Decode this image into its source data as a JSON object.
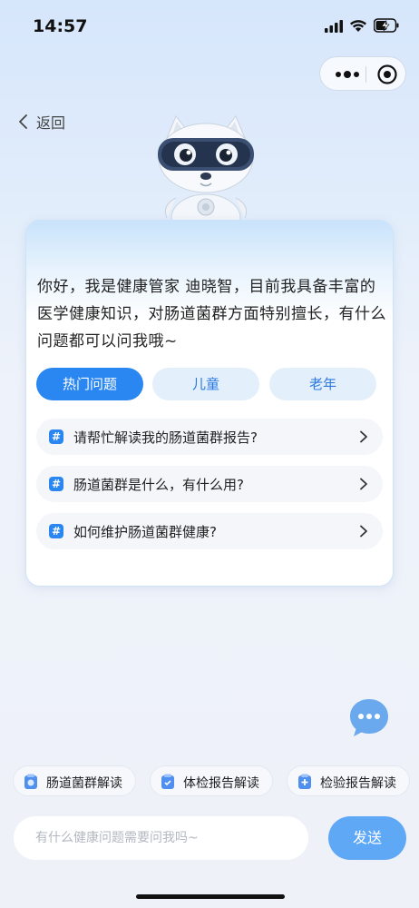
{
  "status_bar": {
    "time": "14:57"
  },
  "nav": {
    "back_label": "返回"
  },
  "card": {
    "greeting": "你好，我是健康管家 迪晓智，目前我具备丰富的医学健康知识，对肠道菌群方面特别擅长，有什么问题都可以问我哦~",
    "tabs": [
      {
        "label": "热门问题",
        "active": true
      },
      {
        "label": "儿童",
        "active": false
      },
      {
        "label": "老年",
        "active": false
      }
    ],
    "questions": [
      {
        "hash": "#",
        "text": "请帮忙解读我的肠道菌群报告?"
      },
      {
        "hash": "#",
        "text": "肠道菌群是什么，有什么用?"
      },
      {
        "hash": "#",
        "text": "如何维护肠道菌群健康?"
      }
    ]
  },
  "quick_actions": [
    {
      "label": "肠道菌群解读",
      "icon": "report-icon"
    },
    {
      "label": "体检报告解读",
      "icon": "checkup-icon"
    },
    {
      "label": "检验报告解读",
      "icon": "lab-icon"
    }
  ],
  "input": {
    "placeholder": "有什么健康问题需要问我吗~",
    "value": ""
  },
  "send_label": "发送",
  "colors": {
    "primary": "#2a86f0",
    "send": "#5fa8f6",
    "tab_inactive_bg": "#e4effc"
  }
}
